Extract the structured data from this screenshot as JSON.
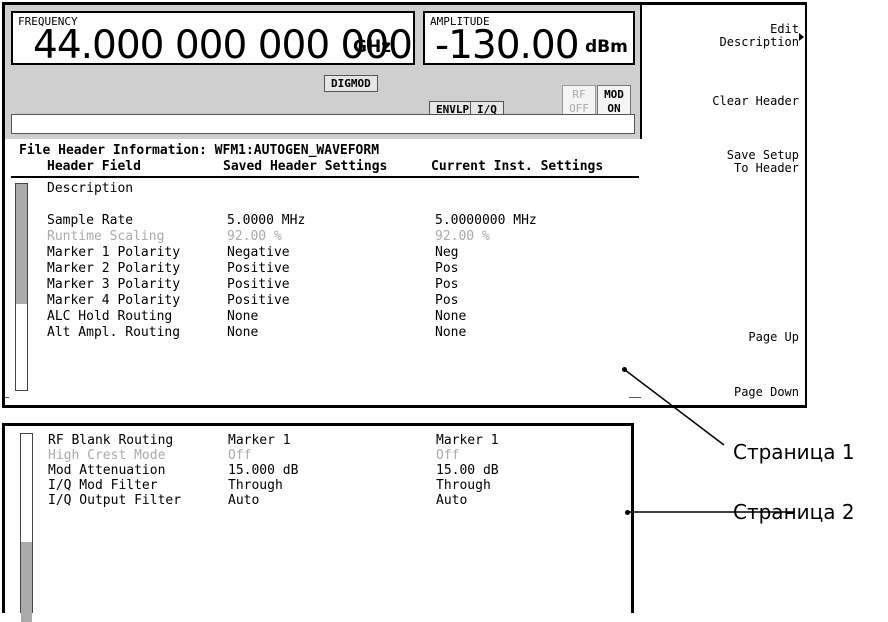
{
  "header": {
    "frequency_label": "FREQUENCY",
    "frequency_value": "44.000 000 000 000",
    "frequency_unit": "GHz",
    "amplitude_label": "AMPLITUDE",
    "amplitude_value": "-130.00",
    "amplitude_unit": "dBm",
    "annunciators": {
      "digmod": "DIGMOD",
      "envlp": "ENVLP",
      "iq": "I/Q",
      "rf_line1": "RF",
      "rf_line2": "OFF",
      "mod_line1": "MOD",
      "mod_line2": "ON"
    }
  },
  "softkeys": {
    "edit_description": [
      "Edit",
      "Description"
    ],
    "clear_header": "Clear Header",
    "save_setup": [
      "Save Setup",
      "To Header"
    ],
    "page_up": "Page Up",
    "page_down": "Page Down"
  },
  "file_header": {
    "title": "File Header Information: WFM1:AUTOGEN_WAVEFORM",
    "columns": [
      "Header Field",
      "Saved Header Settings",
      "Current Inst. Settings"
    ]
  },
  "page1_rows": [
    {
      "field": "Description",
      "saved": "",
      "current": "",
      "dim": false
    },
    {
      "field": "Sample Rate",
      "saved": "5.0000 MHz",
      "current": "5.0000000 MHz",
      "dim": false
    },
    {
      "field": "Runtime Scaling",
      "saved": "92.00 %",
      "current": "92.00 %",
      "dim": true
    },
    {
      "field": "Marker 1 Polarity",
      "saved": "Negative",
      "current": "Neg",
      "dim": false
    },
    {
      "field": "Marker 2 Polarity",
      "saved": "Positive",
      "current": "Pos",
      "dim": false
    },
    {
      "field": "Marker 3 Polarity",
      "saved": "Positive",
      "current": "Pos",
      "dim": false
    },
    {
      "field": "Marker 4 Polarity",
      "saved": "Positive",
      "current": "Pos",
      "dim": false
    },
    {
      "field": "ALC Hold Routing",
      "saved": "None",
      "current": "None",
      "dim": false
    },
    {
      "field": "Alt Ampl. Routing",
      "saved": "None",
      "current": "None",
      "dim": false
    }
  ],
  "page2_rows": [
    {
      "field": "RF Blank Routing",
      "saved": "Marker 1",
      "current": "Marker 1",
      "dim": false
    },
    {
      "field": "High Crest Mode",
      "saved": "Off",
      "current": "Off",
      "dim": true
    },
    {
      "field": "Mod Attenuation",
      "saved": "15.000 dB",
      "current": "15.00 dB",
      "dim": false
    },
    {
      "field": "I/Q Mod Filter",
      "saved": "Through",
      "current": "Through",
      "dim": false
    },
    {
      "field": "I/Q Output Filter",
      "saved": "Auto",
      "current": "Auto",
      "dim": false
    }
  ],
  "callouts": {
    "page1": "Страница 1",
    "page2": "Страница 2"
  }
}
